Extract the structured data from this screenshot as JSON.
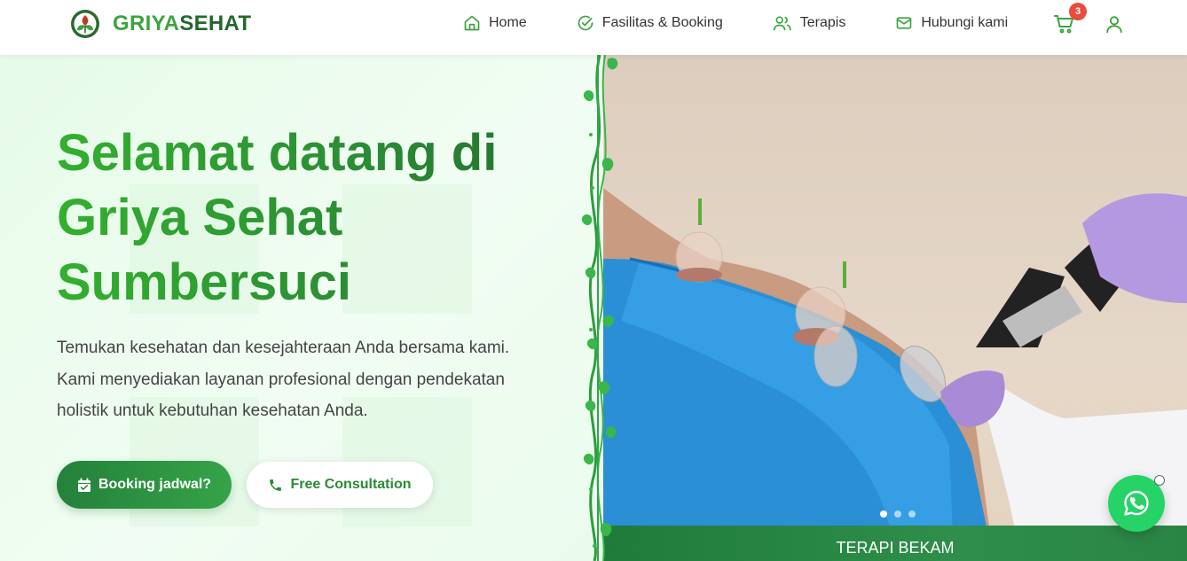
{
  "header": {
    "brand_part1": "GRIYA",
    "brand_part2": "SEHAT",
    "nav": [
      {
        "label": "Home",
        "icon": "home-icon"
      },
      {
        "label": "Fasilitas & Booking",
        "icon": "check-circle-icon"
      },
      {
        "label": "Terapis",
        "icon": "users-icon"
      },
      {
        "label": "Hubungi kami",
        "icon": "mail-icon"
      }
    ],
    "cart_count": "3"
  },
  "hero": {
    "title": "Selamat datang di Griya Sehat Sumbersuci",
    "description": "Temukan kesehatan dan kesejahteraan Anda bersama kami. Kami menyediakan layanan profesional dengan pendekatan holistik untuk kebutuhan kesehatan Anda.",
    "booking_label": "Booking jadwal?",
    "consult_label": "Free Consultation"
  },
  "slider": {
    "caption": "TERAPI BEKAM",
    "slide_count": 3,
    "active_index": 0
  },
  "colors": {
    "brand_green": "#3aa53e",
    "dark_green": "#23682b",
    "whatsapp": "#25d366",
    "badge_red": "#e74c3c"
  }
}
